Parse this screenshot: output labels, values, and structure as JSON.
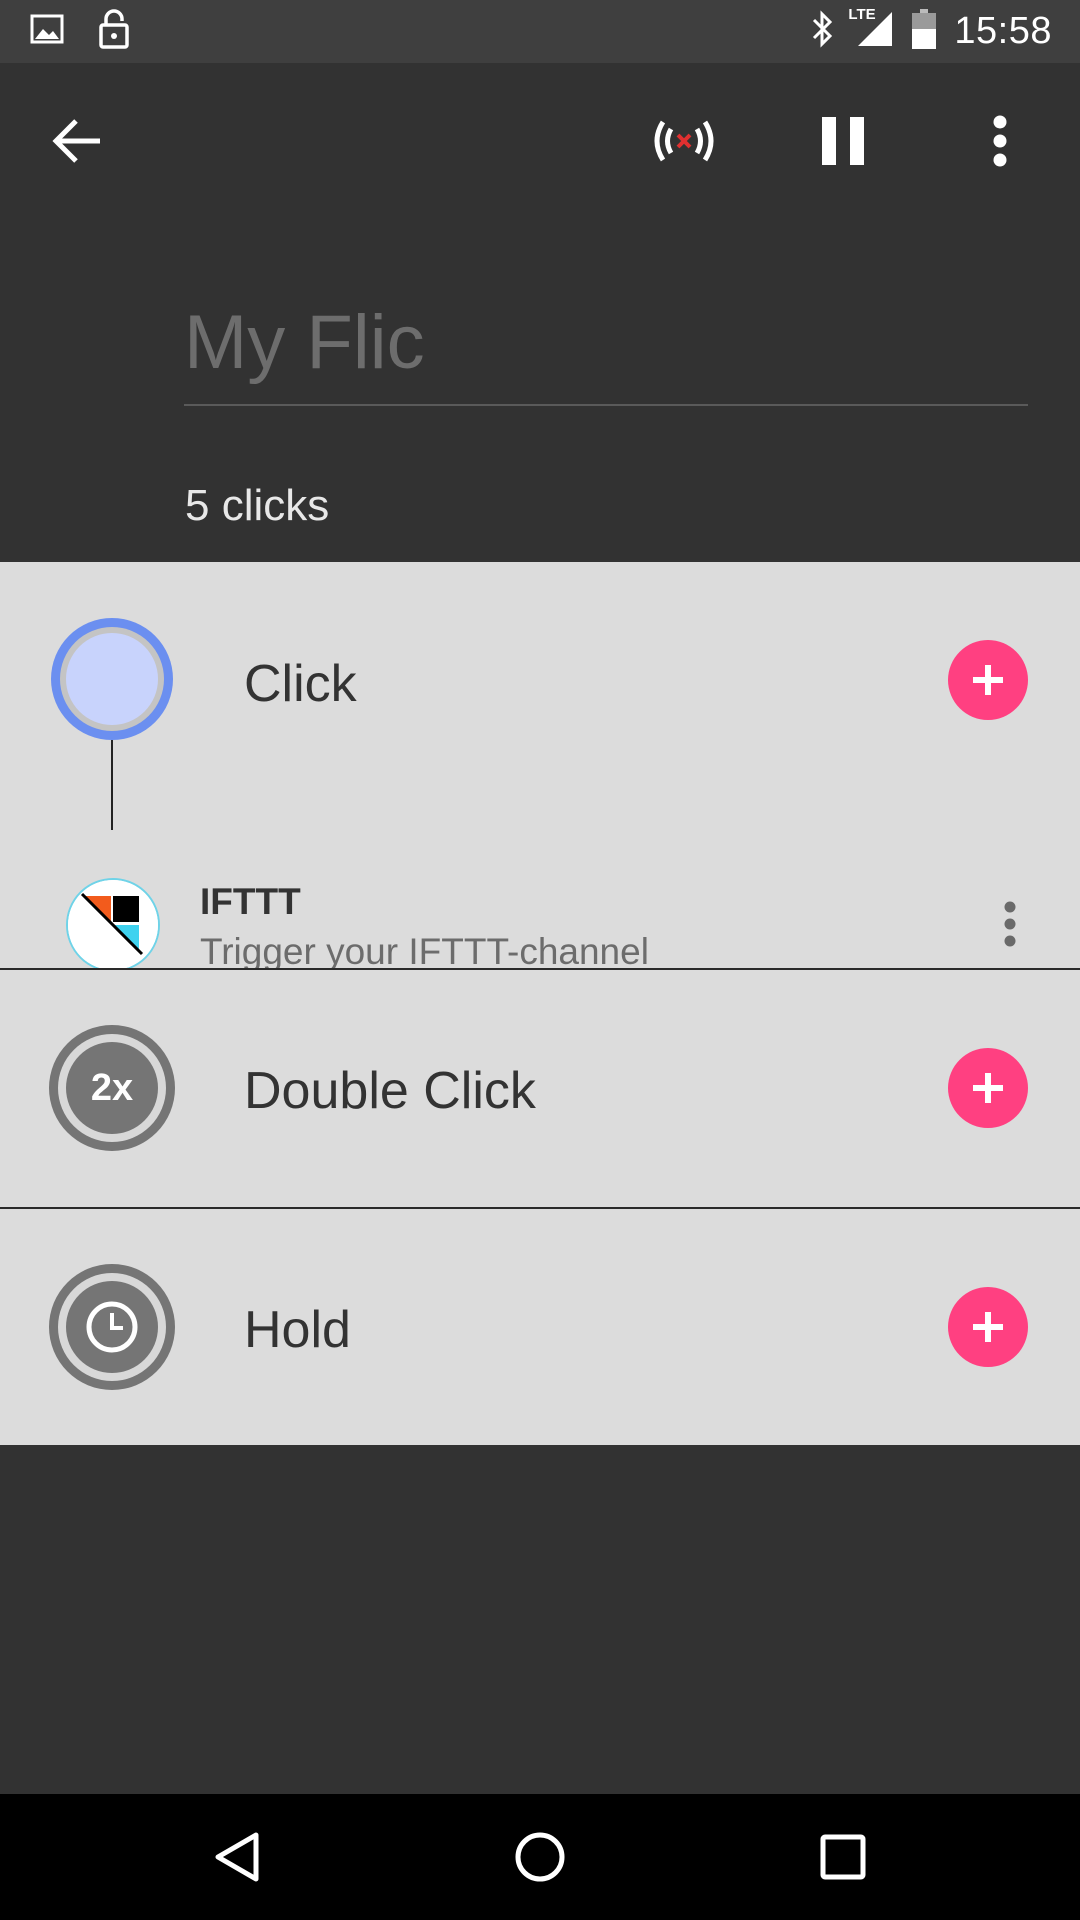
{
  "status_bar": {
    "time": "15:58",
    "network": "LTE",
    "icons": [
      "image-icon",
      "lock-icon",
      "bluetooth-icon",
      "signal-icon",
      "battery-icon"
    ]
  },
  "app_bar": {
    "icons": [
      "back-arrow-icon",
      "connection-error-icon",
      "pause-icon",
      "overflow-menu-icon"
    ]
  },
  "header": {
    "button_name": "My Flic",
    "click_count": "5 clicks"
  },
  "events": {
    "click": {
      "label": "Click",
      "action": {
        "title": "IFTTT",
        "subtitle": "Trigger your IFTTT-channel"
      }
    },
    "double_click": {
      "label": "Double Click",
      "badge": "2x"
    },
    "hold": {
      "label": "Hold"
    }
  },
  "colors": {
    "accent": "#ff4081",
    "click_ring": "#6b8ff0",
    "click_fill": "#c8d3fc",
    "background": "#323232",
    "section": "#dcdcdc"
  }
}
